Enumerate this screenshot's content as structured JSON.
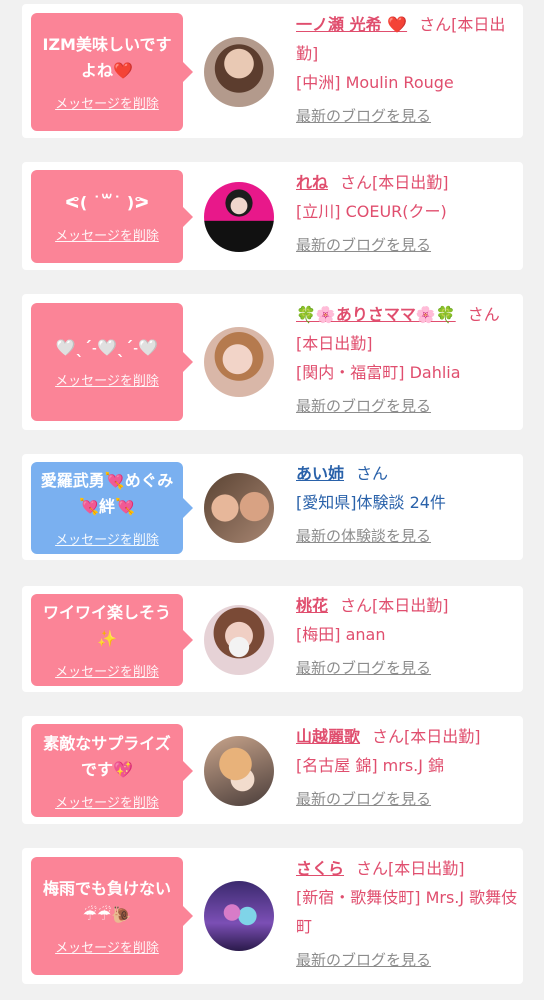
{
  "delete_label": "メッセージを削除",
  "colors": {
    "pink_bubble": "#fb8497",
    "blue_bubble": "#7ab0f0",
    "pink_text": "#e04e6e",
    "blue_text": "#2a62aa",
    "gray_link": "#8c8c8c",
    "background": "#f1f1f1"
  },
  "messages": [
    {
      "text": "IZM美味しいですよね❤️",
      "bubble_color": "pink",
      "name": "一ノ瀬 光希 ❤️",
      "suffix": "さん[本日出勤]",
      "shop": "[中洲] Moulin Rouge",
      "link": "最新のブログを見る"
    },
    {
      "text": "ᕙ( ˙꒳​˙ )ᕗ",
      "bubble_color": "pink",
      "name": "れね",
      "suffix": "さん[本日出勤]",
      "shop": "[立川] COEUR(クー)",
      "link": "最新のブログを見る"
    },
    {
      "text": "🤍ˎˊ˗🤍ˎˊ˗🤍",
      "bubble_color": "pink",
      "name": "🍀🌸ありさママ🌸🍀",
      "suffix": "さん[本日出勤]",
      "shop": "[関内・福富町] Dahlia",
      "link": "最新のブログを見る"
    },
    {
      "text": "愛羅武勇💘めぐみ💘絆💘",
      "bubble_color": "blue",
      "name": "あい姉",
      "suffix": "さん",
      "shop": "[愛知県]体験談 24件",
      "link": "最新の体験談を見る"
    },
    {
      "text": "ワイワイ楽しそう✨",
      "bubble_color": "pink",
      "name": "桃花",
      "suffix": "さん[本日出勤]",
      "shop": "[梅田] anan",
      "link": "最新のブログを見る"
    },
    {
      "text": "素敵なサプライズです💖",
      "bubble_color": "pink",
      "name": "山越麗歌",
      "suffix": "さん[本日出勤]",
      "shop": "[名古屋 錦] mrs.J 錦",
      "link": "最新のブログを見る"
    },
    {
      "text": "梅雨でも負けない☔☔🐌",
      "bubble_color": "pink",
      "name": "さくら",
      "suffix": "さん[本日出勤]",
      "shop": "[新宿・歌舞伎町] Mrs.J 歌舞伎町",
      "link": "最新のブログを見る"
    }
  ]
}
